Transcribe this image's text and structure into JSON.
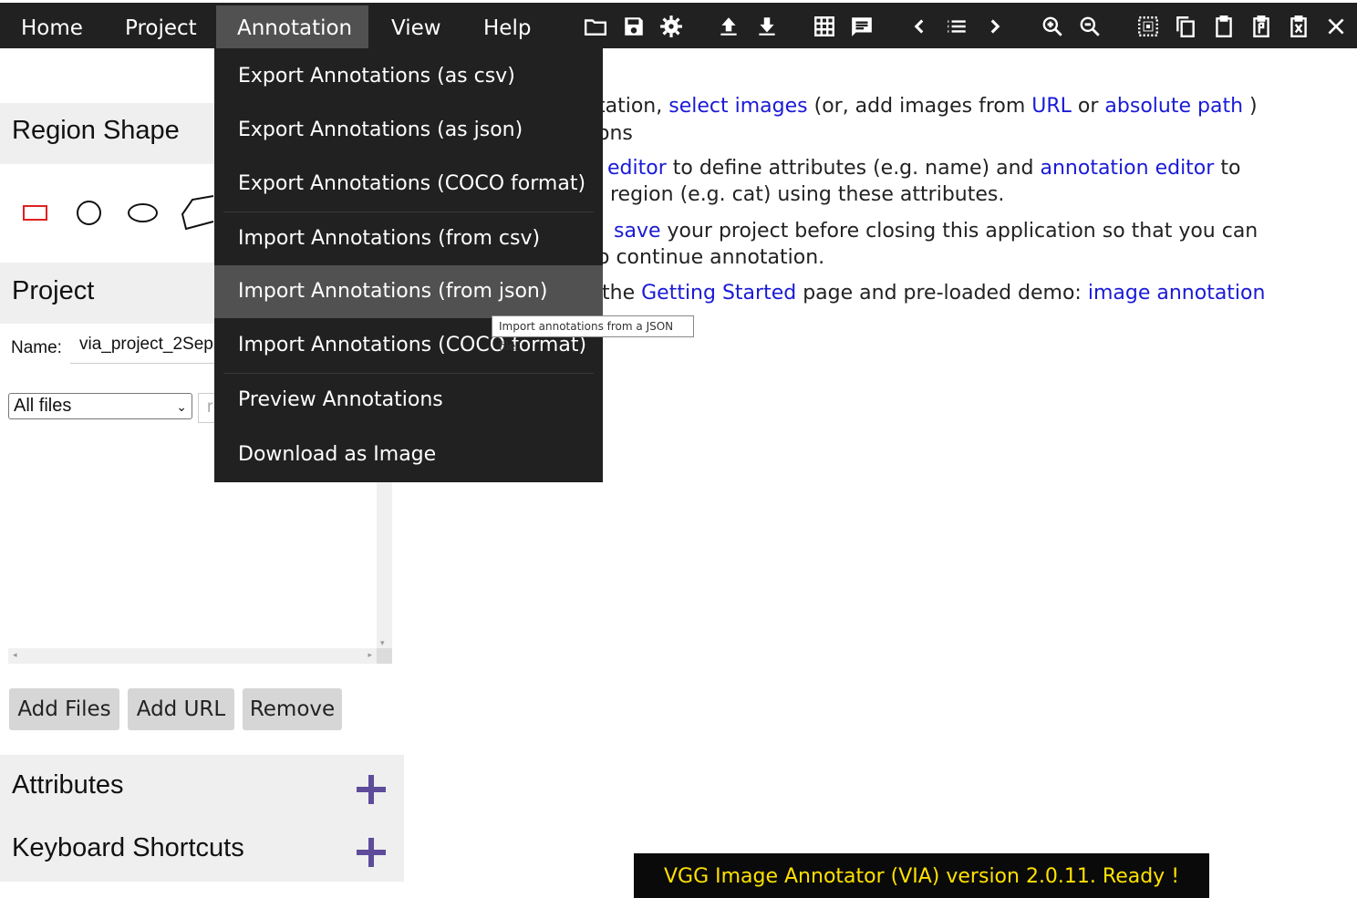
{
  "menubar": {
    "items": [
      "Home",
      "Project",
      "Annotation",
      "View",
      "Help"
    ],
    "active": "Annotation"
  },
  "toolbar_icons": [
    "folder-open-icon",
    "save-icon",
    "settings-icon",
    "upload-icon",
    "download-icon",
    "grid-view-icon",
    "comment-icon",
    "previous-icon",
    "list-icon",
    "next-icon",
    "zoom-in-icon",
    "zoom-out-icon",
    "select-all-icon",
    "copy-icon",
    "paste-icon",
    "paste-multiple-icon",
    "delete-icon",
    "close-icon"
  ],
  "annotation_menu": {
    "items": [
      "Export Annotations (as csv)",
      "Export Annotations (as json)",
      "Export Annotations (COCO format)",
      "Import Annotations (from csv)",
      "Import Annotations (from json)",
      "Import Annotations (COCO format)",
      "Preview Annotations",
      "Download as Image"
    ],
    "hovered": "Import Annotations (from json)",
    "tooltip": "Import annotations from a JSON file"
  },
  "region_shape": {
    "title": "Region Shape",
    "shapes": [
      "rectangle",
      "circle",
      "ellipse",
      "polygon"
    ],
    "selected": "rectangle",
    "selected_color": "#e02020"
  },
  "project": {
    "title": "Project",
    "name_label": "Name:",
    "name_value": "via_project_2Sep",
    "filter_select": "All files",
    "filter_placeholder": "r",
    "buttons": {
      "add_files": "Add Files",
      "add_url": "Add URL",
      "remove": "Remove"
    }
  },
  "attributes": {
    "title": "Attributes"
  },
  "shortcuts": {
    "title": "Keyboard Shortcuts"
  },
  "content": {
    "line1": {
      "pre": "tation, ",
      "link1": "select images",
      "mid1": " (or, add images from ",
      "link2": "URL",
      "mid2": " or ",
      "link3": "absolute path",
      "post": ")"
    },
    "line2": "ons",
    "line3": {
      "link1": "editor",
      "mid": " to define attributes (e.g. name) and ",
      "link2": "annotation editor",
      "post": " to"
    },
    "line4": "region (e.g. cat) using these attributes.",
    "line5": {
      "link": "save",
      "post": " your project before closing this application so that you can"
    },
    "line6": "o continue annotation.",
    "line7": {
      "pre": "the ",
      "link1": "Getting Started",
      "mid": " page and pre-loaded demo: ",
      "link2": "image annotation"
    }
  },
  "status_bar": "VGG Image Annotator (VIA) version 2.0.11. Ready !",
  "colors": {
    "navbar": "#212121",
    "active_menu": "#515151",
    "link": "#1a1ad6",
    "status_text": "#ffe100",
    "plus_icon": "#5e4c9b"
  }
}
